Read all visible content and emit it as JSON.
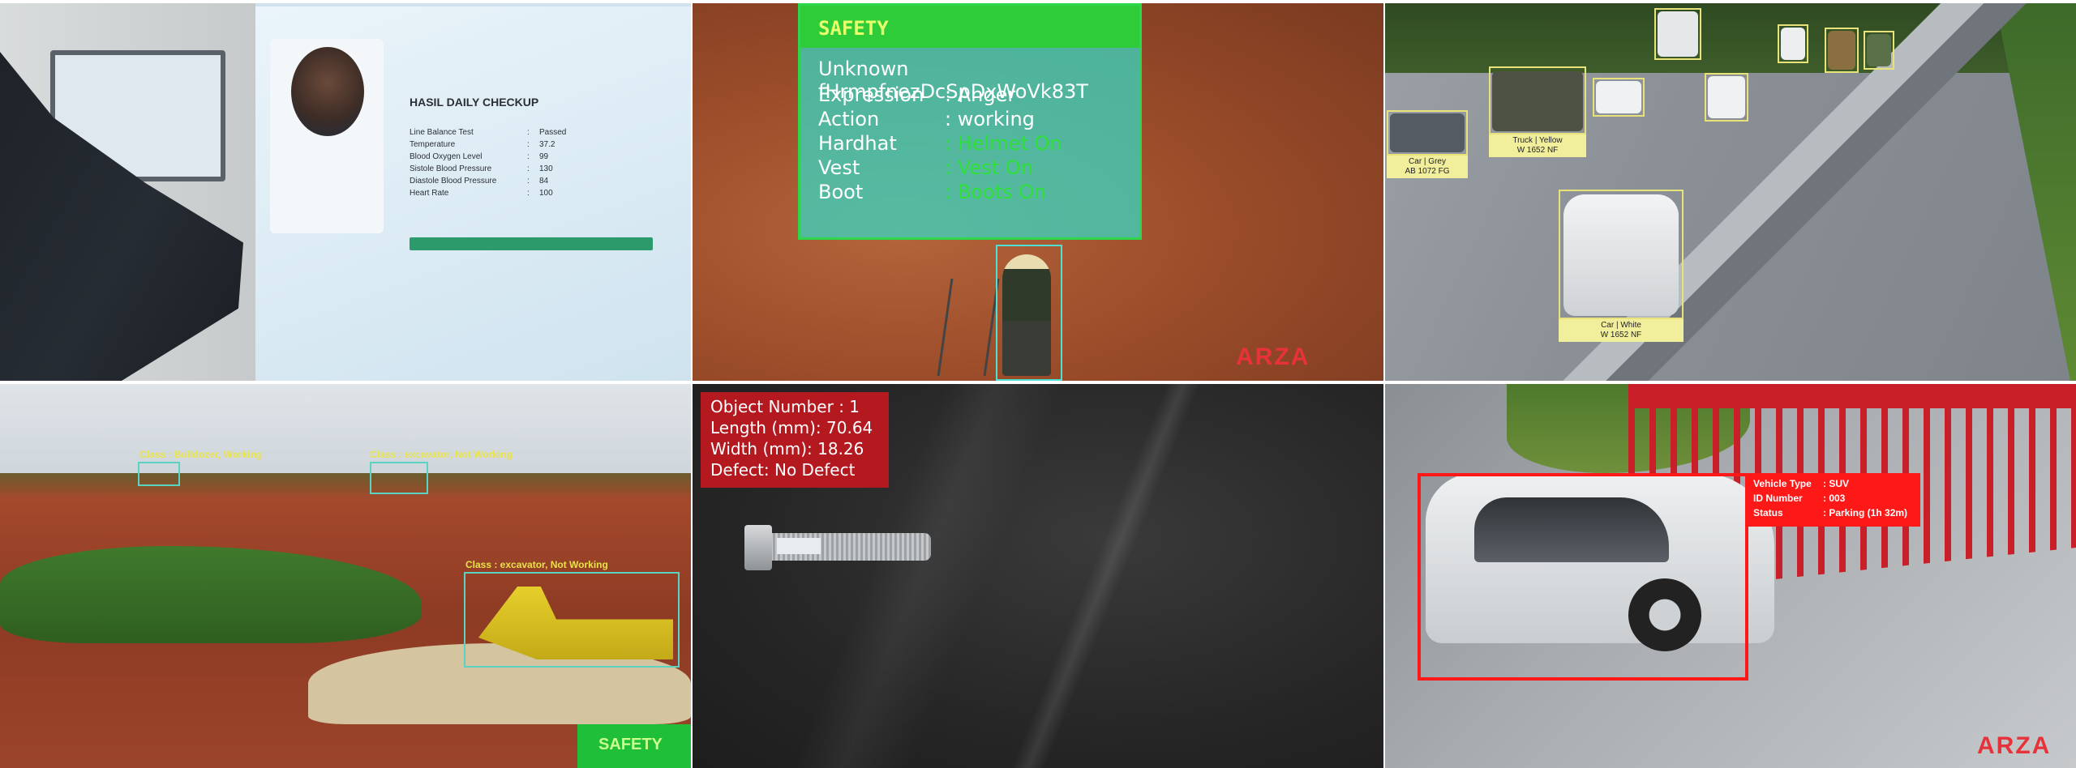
{
  "kiosk": {
    "title": "HASIL DAILY CHECKUP",
    "rows": [
      {
        "label": "Line Balance Test",
        "value": "Passed"
      },
      {
        "label": "Temperature",
        "value": "37.2"
      },
      {
        "label": "Blood Oxygen Level",
        "value": "99"
      },
      {
        "label": "Sistole Blood Pressure",
        "value": "130"
      },
      {
        "label": "Diastole Blood Pressure",
        "value": "84"
      },
      {
        "label": "Heart Rate",
        "value": "100"
      }
    ],
    "separator": ":",
    "button_color": "#2c9a6a"
  },
  "safety_panel": {
    "header": "SAFETY",
    "name_line": "Unknown fHrmpfnezDcSpDxWoVk83T",
    "rows": [
      {
        "label": "Expression",
        "value": ": Anger",
        "status": "neutral"
      },
      {
        "label": "Action",
        "value": ": working",
        "status": "neutral"
      },
      {
        "label": "Hardhat",
        "value": ": Helmet On",
        "status": "ok"
      },
      {
        "label": "Vest",
        "value": ": Vest On",
        "status": "ok"
      },
      {
        "label": "Boot",
        "value": ": Boots On",
        "status": "ok"
      }
    ],
    "logo": "ARZA",
    "box_color": "#2dd64a",
    "ok_color": "#2fe03b"
  },
  "traffic": {
    "labels": [
      {
        "class": "Car | Grey",
        "plate": "AB 1072 FG"
      },
      {
        "class": "Truck | Yellow",
        "plate": "W 1652 NF"
      },
      {
        "class": "Car | White",
        "plate": "W 1652 NF"
      }
    ],
    "box_color": "#e7e27a"
  },
  "construction": {
    "labels": [
      "Class : Bulldozer, Working",
      "Class : excavator, Not Working",
      "Class : excavator, Not Working"
    ],
    "safety_tag": "SAFETY",
    "box_color": "#5ad3c2"
  },
  "inspection": {
    "lines": [
      "Object Number : 1",
      "Length (mm): 70.64",
      "Width (mm): 18.26",
      "Defect: No Defect"
    ],
    "bg_color": "#b3191f"
  },
  "parking": {
    "rows": [
      {
        "label": "Vehicle Type",
        "value": ": SUV"
      },
      {
        "label": "ID Number",
        "value": ": 003"
      },
      {
        "label": "Status",
        "value": ": Parking  (1h 32m)"
      }
    ],
    "logo": "ARZA",
    "box_color": "#ff1818"
  }
}
